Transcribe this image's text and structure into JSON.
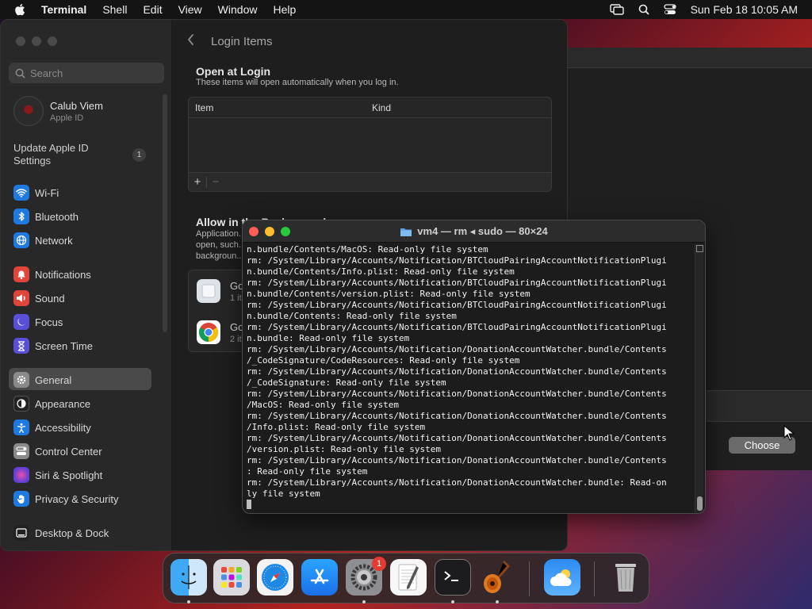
{
  "menubar": {
    "app_name": "Terminal",
    "items": [
      "Shell",
      "Edit",
      "View",
      "Window",
      "Help"
    ],
    "datetime": "Sun Feb 18  10:05 AM"
  },
  "settings": {
    "search_placeholder": "Search",
    "profile": {
      "name": "Calub Viem",
      "sub": "Apple ID"
    },
    "update_label": "Update Apple ID Settings",
    "update_count": "1",
    "sidebar": [
      {
        "label": "Wi-Fi",
        "icon": "wifi-icon",
        "color": "#1f7ae0"
      },
      {
        "label": "Bluetooth",
        "icon": "bluetooth-icon",
        "color": "#1f7ae0"
      },
      {
        "label": "Network",
        "icon": "globe-icon",
        "color": "#1f7ae0"
      },
      {
        "label": "Notifications",
        "icon": "bell-icon",
        "color": "#e0443a"
      },
      {
        "label": "Sound",
        "icon": "speaker-icon",
        "color": "#e0443a"
      },
      {
        "label": "Focus",
        "icon": "moon-icon",
        "color": "#5a4fd8"
      },
      {
        "label": "Screen Time",
        "icon": "hourglass-icon",
        "color": "#5a4fd8"
      },
      {
        "label": "General",
        "icon": "gear-icon",
        "color": "#8a8a8a"
      },
      {
        "label": "Appearance",
        "icon": "appearance-icon",
        "color": "#222222"
      },
      {
        "label": "Accessibility",
        "icon": "accessibility-icon",
        "color": "#1f7ae0"
      },
      {
        "label": "Control Center",
        "icon": "control-center-icon",
        "color": "#8a8a8a"
      },
      {
        "label": "Siri & Spotlight",
        "icon": "siri-icon",
        "color": "#b04ad8"
      },
      {
        "label": "Privacy & Security",
        "icon": "hand-icon",
        "color": "#1f7ae0"
      },
      {
        "label": "Desktop & Dock",
        "icon": "dock-icon",
        "color": "#222222"
      }
    ],
    "active_item": "General",
    "page_title": "Login Items",
    "open_at_login": {
      "title": "Open at Login",
      "subtitle": "These items will open automatically when you log in.",
      "columns": [
        "Item",
        "Kind"
      ],
      "add_label": "+",
      "remove_label": "−"
    },
    "allow_background": {
      "title": "Allow in the Background",
      "subtitle": "Application... open, such... backgroun...",
      "rows": [
        {
          "name": "Go",
          "count": "1 it",
          "icon": "generic-app-icon"
        },
        {
          "name": "Go",
          "count": "2 it",
          "icon": "chrome-icon"
        }
      ]
    }
  },
  "background_window": {
    "choose_label": "Choose"
  },
  "terminal": {
    "title": "vm4 — rm ◂ sudo — 80×24",
    "lines": [
      "n.bundle/Contents/MacOS: Read-only file system",
      "rm: /System/Library/Accounts/Notification/BTCloudPairingAccountNotificationPlugi",
      "n.bundle/Contents/Info.plist: Read-only file system",
      "rm: /System/Library/Accounts/Notification/BTCloudPairingAccountNotificationPlugi",
      "n.bundle/Contents/version.plist: Read-only file system",
      "rm: /System/Library/Accounts/Notification/BTCloudPairingAccountNotificationPlugi",
      "n.bundle/Contents: Read-only file system",
      "rm: /System/Library/Accounts/Notification/BTCloudPairingAccountNotificationPlugi",
      "n.bundle: Read-only file system",
      "rm: /System/Library/Accounts/Notification/DonationAccountWatcher.bundle/Contents",
      "/_CodeSignature/CodeResources: Read-only file system",
      "rm: /System/Library/Accounts/Notification/DonationAccountWatcher.bundle/Contents",
      "/_CodeSignature: Read-only file system",
      "rm: /System/Library/Accounts/Notification/DonationAccountWatcher.bundle/Contents",
      "/MacOS: Read-only file system",
      "rm: /System/Library/Accounts/Notification/DonationAccountWatcher.bundle/Contents",
      "/Info.plist: Read-only file system",
      "rm: /System/Library/Accounts/Notification/DonationAccountWatcher.bundle/Contents",
      "/version.plist: Read-only file system",
      "rm: /System/Library/Accounts/Notification/DonationAccountWatcher.bundle/Contents",
      ": Read-only file system",
      "rm: /System/Library/Accounts/Notification/DonationAccountWatcher.bundle: Read-on",
      "ly file system"
    ]
  },
  "dock": {
    "apps": [
      {
        "name": "finder-icon",
        "running": true
      },
      {
        "name": "launchpad-icon",
        "running": false
      },
      {
        "name": "safari-icon",
        "running": false
      },
      {
        "name": "app-store-icon",
        "running": false
      },
      {
        "name": "system-settings-icon",
        "running": true,
        "badge": "1"
      },
      {
        "name": "textedit-icon",
        "running": false
      },
      {
        "name": "terminal-icon",
        "running": true
      },
      {
        "name": "garageband-icon",
        "running": true
      },
      {
        "name": "weather-icon",
        "running": false
      },
      {
        "name": "trash-icon",
        "running": false
      }
    ]
  }
}
